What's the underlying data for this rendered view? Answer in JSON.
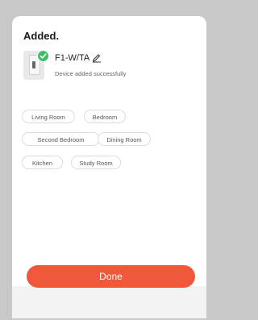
{
  "dialog": {
    "title": "Added.",
    "device": {
      "name": "F1-W/TA",
      "status": "Device added successfully",
      "image_icon": "device-image",
      "badge_icon": "check-circle-icon",
      "edit_icon": "pencil-icon"
    },
    "rooms": [
      "Living Room",
      "Bedroom",
      "Second Bedroom",
      "Dining Room",
      "Kitchen",
      "Study Room"
    ],
    "done_label": "Done"
  },
  "colors": {
    "accent": "#f0573b",
    "success": "#3dbf6a",
    "backdrop": "#c8c8c8"
  }
}
